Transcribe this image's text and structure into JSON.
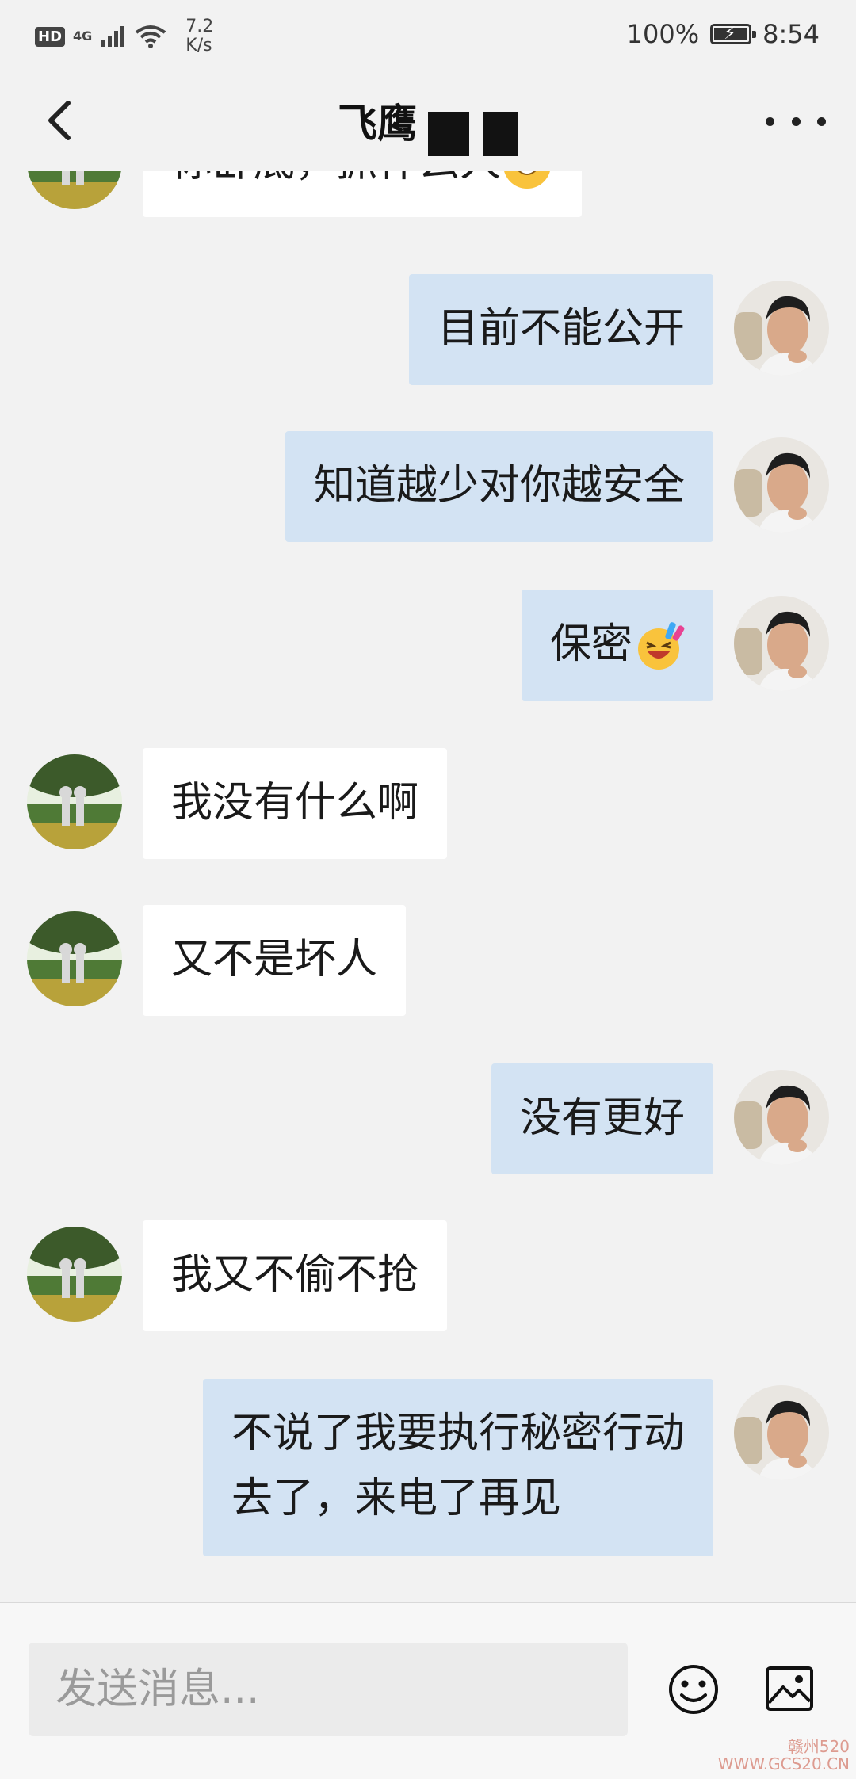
{
  "status_bar": {
    "hd": "HD",
    "network": "4G",
    "speed_value": "7.2",
    "speed_unit": "K/s",
    "battery": "100%",
    "battery_level": 1.0,
    "time": "8:54"
  },
  "header": {
    "title": "飞鹰",
    "back_icon": "chevron-left-icon",
    "more_icon": "more-dots-icon"
  },
  "messages": [
    {
      "side": "left",
      "text": "你卧底，抓什么人",
      "emoji": "grin-emoji"
    },
    {
      "side": "right",
      "text": "目前不能公开"
    },
    {
      "side": "right",
      "text": "知道越少对你越安全"
    },
    {
      "side": "right",
      "text": "保密",
      "emoji": "party-emoji"
    },
    {
      "side": "left",
      "text": "我没有什么啊"
    },
    {
      "side": "left",
      "text": "又不是坏人"
    },
    {
      "side": "right",
      "text": "没有更好"
    },
    {
      "side": "left",
      "text": "我又不偷不抢"
    },
    {
      "side": "right",
      "text": "不说了我要执行秘密行动\n去了，来电了再见"
    }
  ],
  "input": {
    "placeholder": "发送消息...",
    "emoji_icon": "smiley-icon",
    "image_icon": "image-icon"
  },
  "watermark": {
    "line1": "赣州520",
    "line2": "WWW.GCS20.CN"
  },
  "colors": {
    "background": "#f2f2f2",
    "bubble_left": "#ffffff",
    "bubble_right": "#d3e3f3"
  }
}
